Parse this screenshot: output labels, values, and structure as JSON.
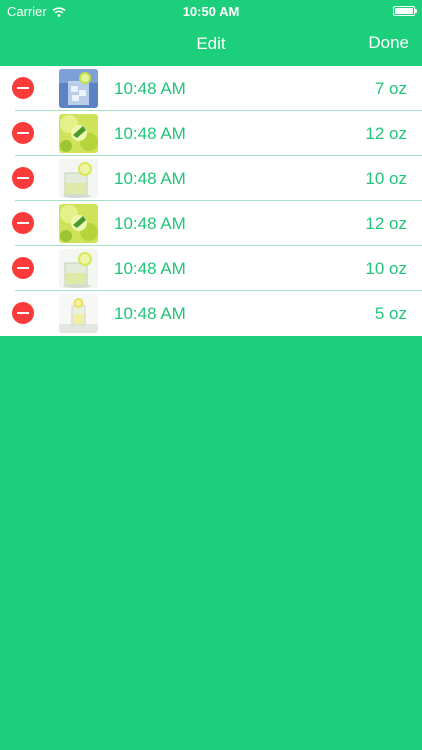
{
  "status_bar": {
    "carrier": "Carrier",
    "time": "10:50 AM"
  },
  "nav": {
    "title": "Edit",
    "done_label": "Done"
  },
  "colors": {
    "background": "#1ccf7a",
    "accent_text": "#22c47a",
    "delete": "#fb3a3a"
  },
  "entries": [
    {
      "time": "10:48 AM",
      "amount": "7 oz",
      "image": "ice-water-drink-image"
    },
    {
      "time": "10:48 AM",
      "amount": "12 oz",
      "image": "lime-mint-drink-image"
    },
    {
      "time": "10:48 AM",
      "amount": "10 oz",
      "image": "lemon-water-glass-image"
    },
    {
      "time": "10:48 AM",
      "amount": "12 oz",
      "image": "lime-mint-drink-image"
    },
    {
      "time": "10:48 AM",
      "amount": "10 oz",
      "image": "lemon-water-glass-image"
    },
    {
      "time": "10:48 AM",
      "amount": "5 oz",
      "image": "small-lemon-glass-image"
    }
  ]
}
